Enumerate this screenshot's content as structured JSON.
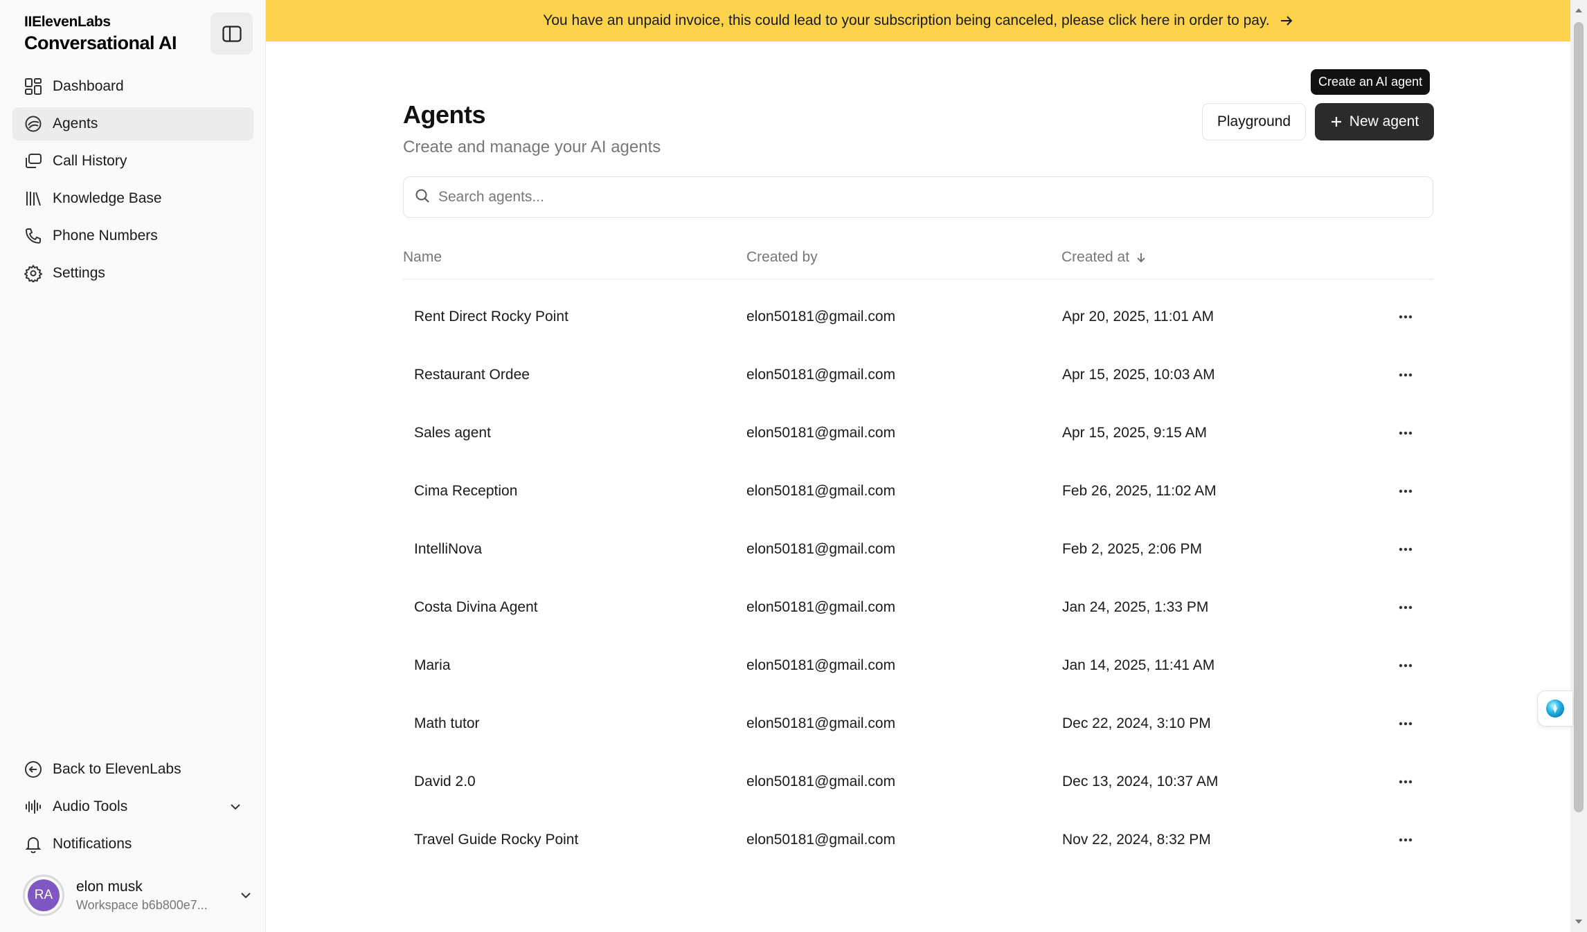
{
  "brand": {
    "company": "IIElevenLabs",
    "product": "Conversational AI"
  },
  "sidebar": {
    "items": [
      {
        "label": "Dashboard",
        "icon": "dashboard-icon"
      },
      {
        "label": "Agents",
        "icon": "agents-icon",
        "active": true
      },
      {
        "label": "Call History",
        "icon": "call-history-icon"
      },
      {
        "label": "Knowledge Base",
        "icon": "knowledge-base-icon"
      },
      {
        "label": "Phone Numbers",
        "icon": "phone-icon"
      },
      {
        "label": "Settings",
        "icon": "gear-icon"
      }
    ],
    "bottom": [
      {
        "label": "Back to ElevenLabs",
        "icon": "back-arrow-icon"
      },
      {
        "label": "Audio Tools",
        "icon": "audio-waveform-icon"
      },
      {
        "label": "Notifications",
        "icon": "bell-icon"
      }
    ]
  },
  "user": {
    "initials": "RA",
    "name": "elon musk",
    "workspace": "Workspace b6b800e7..."
  },
  "banner": {
    "text": "You have an unpaid invoice, this could lead to your subscription being canceled, please click here in order to pay.",
    "color": "#fdd34e"
  },
  "page": {
    "title": "Agents",
    "subtitle": "Create and manage your AI agents",
    "tooltip": "Create an AI agent",
    "playground_label": "Playground",
    "new_agent_label": "New agent",
    "search_placeholder": "Search agents..."
  },
  "table": {
    "headers": {
      "name": "Name",
      "created_by": "Created by",
      "created_at": "Created at"
    },
    "rows": [
      {
        "name": "Rent Direct Rocky Point",
        "created_by": "elon50181@gmail.com",
        "created_at": "Apr 20, 2025, 11:01 AM"
      },
      {
        "name": "Restaurant Ordee",
        "created_by": "elon50181@gmail.com",
        "created_at": "Apr 15, 2025, 10:03 AM"
      },
      {
        "name": "Sales agent",
        "created_by": "elon50181@gmail.com",
        "created_at": "Apr 15, 2025, 9:15 AM"
      },
      {
        "name": "Cima Reception",
        "created_by": "elon50181@gmail.com",
        "created_at": "Feb 26, 2025, 11:02 AM"
      },
      {
        "name": "IntelliNova",
        "created_by": "elon50181@gmail.com",
        "created_at": "Feb 2, 2025, 2:06 PM"
      },
      {
        "name": "Costa Divina Agent",
        "created_by": "elon50181@gmail.com",
        "created_at": "Jan 24, 2025, 1:33 PM"
      },
      {
        "name": "Maria",
        "created_by": "elon50181@gmail.com",
        "created_at": "Jan 14, 2025, 11:41 AM"
      },
      {
        "name": "Math tutor",
        "created_by": "elon50181@gmail.com",
        "created_at": "Dec 22, 2024, 3:10 PM"
      },
      {
        "name": "David 2.0",
        "created_by": "elon50181@gmail.com",
        "created_at": "Dec 13, 2024, 10:37 AM"
      },
      {
        "name": "Travel Guide Rocky Point",
        "created_by": "elon50181@gmail.com",
        "created_at": "Nov 22, 2024, 8:32 PM"
      }
    ]
  }
}
